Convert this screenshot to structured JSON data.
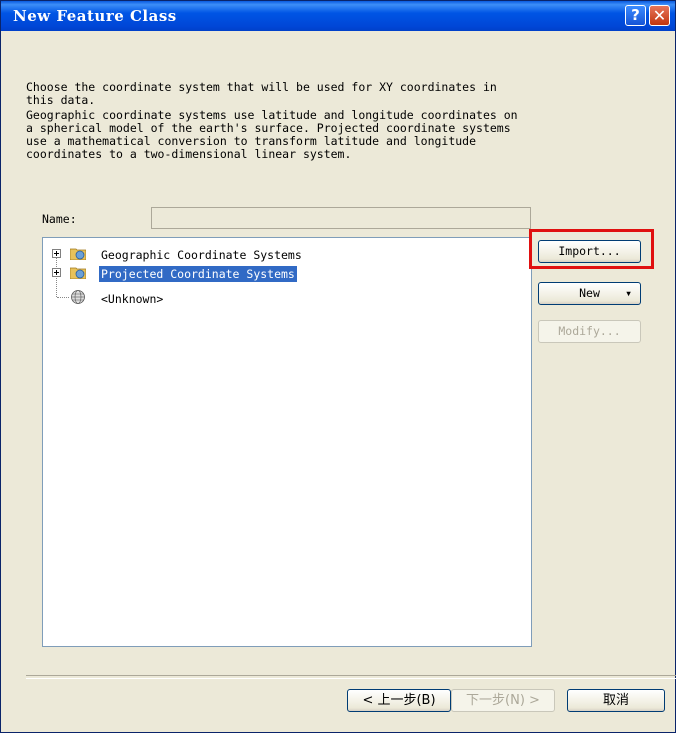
{
  "window": {
    "title": "New Feature Class",
    "help_glyph": "?",
    "close_glyph": "✕"
  },
  "description": {
    "line1": "Choose the coordinate system that will be used for XY coordinates in",
    "line2": "this data.",
    "line3": "Geographic coordinate systems use latitude and longitude coordinates on",
    "line4": "a spherical model of the earth's surface. Projected coordinate systems",
    "line5": "use a mathematical conversion to transform latitude and longitude",
    "line6": "coordinates to a two-dimensional linear system."
  },
  "name_field": {
    "label": "Name:",
    "value": ""
  },
  "tree": {
    "items": [
      {
        "label": "Geographic Coordinate Systems",
        "expandable": true,
        "selected": false
      },
      {
        "label": "Projected Coordinate Systems",
        "expandable": true,
        "selected": true
      },
      {
        "label": "<Unknown>",
        "expandable": false,
        "selected": false
      }
    ]
  },
  "side_buttons": {
    "import_label": "Import...",
    "new_label": "New",
    "new_arrow": "▾",
    "modify_label": "Modify..."
  },
  "footer_buttons": {
    "back_label": "< 上一步(B)",
    "next_label": "下一步(N) >",
    "cancel_label": "取消"
  }
}
